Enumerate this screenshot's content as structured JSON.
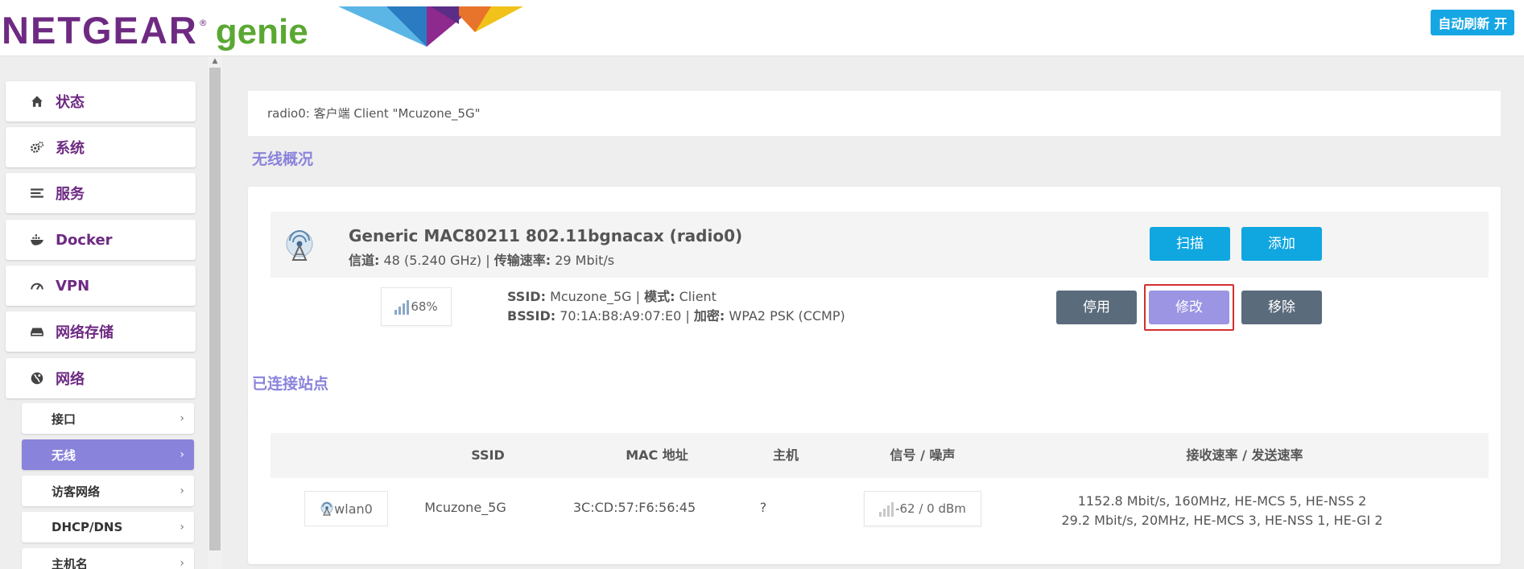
{
  "header": {
    "logo_primary": "NETGEAR",
    "logo_registered": "®",
    "logo_secondary": "genie",
    "auto_refresh_label": "自动刷新 开"
  },
  "sidebar": {
    "items": [
      {
        "label": "状态",
        "icon": "home-icon"
      },
      {
        "label": "系统",
        "icon": "gears-icon"
      },
      {
        "label": "服务",
        "icon": "list-icon"
      },
      {
        "label": "Docker",
        "icon": "docker-icon"
      },
      {
        "label": "VPN",
        "icon": "gauge-icon"
      },
      {
        "label": "网络存储",
        "icon": "drive-icon"
      },
      {
        "label": "网络",
        "icon": "globe-icon"
      }
    ],
    "subitems": [
      {
        "label": "接口",
        "active": false
      },
      {
        "label": "无线",
        "active": true
      },
      {
        "label": "访客网络",
        "active": false
      },
      {
        "label": "DHCP/DNS",
        "active": false
      },
      {
        "label": "主机名",
        "active": false
      }
    ]
  },
  "main": {
    "page_title": "radio0: 客户端 Client \"Mcuzone_5G\"",
    "overview_heading": "无线概况",
    "device": {
      "name": "Generic MAC80211 802.11bgnacax (radio0)",
      "channel_label": "信道:",
      "channel_value": "48 (5.240 GHz)",
      "rate_label": "传输速率:",
      "rate_value": "29 Mbit/s",
      "scan_label": "扫描",
      "add_label": "添加"
    },
    "network": {
      "signal_percent": "68%",
      "ssid_label": "SSID:",
      "ssid_value": "Mcuzone_5G",
      "mode_label": "模式:",
      "mode_value": "Client",
      "bssid_label": "BSSID:",
      "bssid_value": "70:1A:B8:A9:07:E0",
      "encryption_label": "加密:",
      "encryption_value": "WPA2 PSK (CCMP)",
      "disable_label": "停用",
      "edit_label": "修改",
      "remove_label": "移除"
    },
    "stations_heading": "已连接站点",
    "stations_table": {
      "columns": [
        "SSID",
        "MAC 地址",
        "主机",
        "信号 / 噪声",
        "接收速率 / 发送速率"
      ],
      "rows": [
        {
          "interface": "wlan0",
          "ssid": "Mcuzone_5G",
          "mac": "3C:CD:57:F6:56:45",
          "host": "?",
          "signal_noise": "-62 / 0 dBm",
          "rx_rate": "1152.8 Mbit/s, 160MHz, HE-MCS 5, HE-NSS 2",
          "tx_rate": "29.2 Mbit/s, 20MHz, HE-MCS 3, HE-NSS 1, HE-GI 2"
        }
      ]
    }
  },
  "colors": {
    "brand_purple": "#6e2a82",
    "brand_green": "#5aa832",
    "accent_blue": "#10a6e0",
    "active_purple": "#8a83db",
    "button_gray": "#5a6b7c",
    "highlight_red": "#d22f2f"
  }
}
